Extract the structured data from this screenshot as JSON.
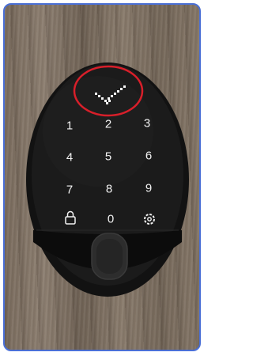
{
  "device": {
    "status_icon": "checkmark-dots-icon",
    "keys": [
      {
        "label": "1",
        "type": "digit"
      },
      {
        "label": "2",
        "type": "digit"
      },
      {
        "label": "3",
        "type": "digit"
      },
      {
        "label": "4",
        "type": "digit"
      },
      {
        "label": "5",
        "type": "digit"
      },
      {
        "label": "6",
        "type": "digit"
      },
      {
        "label": "7",
        "type": "digit"
      },
      {
        "label": "8",
        "type": "digit"
      },
      {
        "label": "9",
        "type": "digit"
      },
      {
        "label": "",
        "type": "lock",
        "icon": "lock-icon"
      },
      {
        "label": "0",
        "type": "digit"
      },
      {
        "label": "",
        "type": "settings",
        "icon": "gear-icon"
      }
    ],
    "fingerprint_icon": "fingerprint-sensor",
    "highlight_color": "#d81f2a",
    "frame_color": "#4a6fd6"
  }
}
